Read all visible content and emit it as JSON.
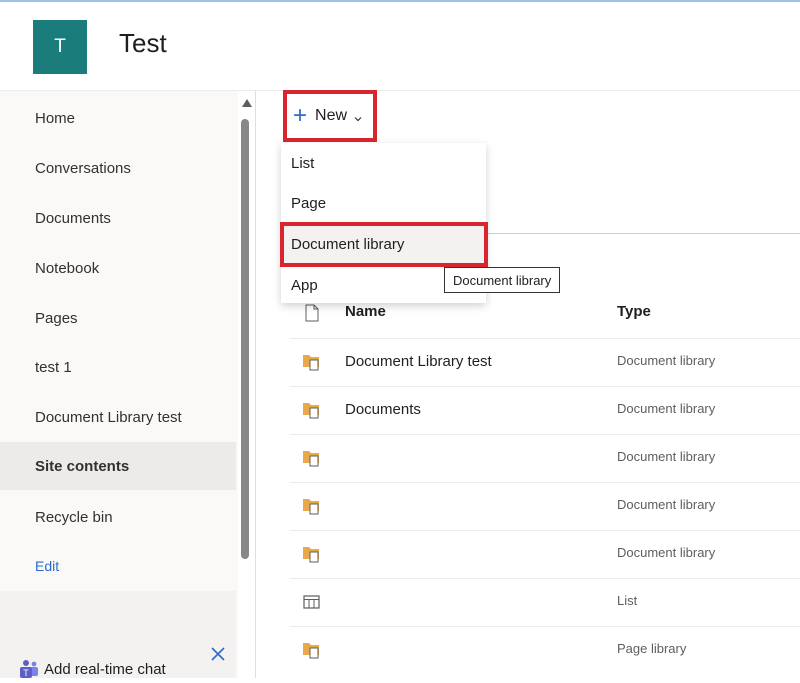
{
  "site": {
    "logo_letter": "T",
    "title": "Test"
  },
  "leftnav": {
    "items": [
      {
        "label": "Home"
      },
      {
        "label": "Conversations"
      },
      {
        "label": "Documents"
      },
      {
        "label": "Notebook"
      },
      {
        "label": "Pages"
      },
      {
        "label": "test 1"
      },
      {
        "label": "Document Library test"
      },
      {
        "label": "Site contents",
        "active": true
      },
      {
        "label": "Recycle bin"
      }
    ],
    "edit_label": "Edit",
    "chat_label": "Add real-time chat"
  },
  "toolbar": {
    "new_label": "New"
  },
  "new_menu": {
    "items": [
      "List",
      "Page",
      "Document library",
      "App"
    ],
    "highlighted": "Document library"
  },
  "tooltip": "Document library",
  "table": {
    "columns": {
      "name": "Name",
      "type": "Type"
    },
    "rows": [
      {
        "name": "Document Library test",
        "type": "Document library",
        "icon": "library-icon"
      },
      {
        "name": "Documents",
        "type": "Document library",
        "icon": "library-icon"
      },
      {
        "name": "",
        "type": "Document library",
        "icon": "library-icon"
      },
      {
        "name": "",
        "type": "Document library",
        "icon": "library-icon"
      },
      {
        "name": "",
        "type": "Document library",
        "icon": "library-icon"
      },
      {
        "name": "",
        "type": "List",
        "icon": "list-icon"
      },
      {
        "name": "",
        "type": "Page library",
        "icon": "library-icon"
      }
    ]
  },
  "colors": {
    "brand": "#1b7d7b",
    "accent": "#2b6bc9",
    "highlight_border": "#d9262e"
  }
}
